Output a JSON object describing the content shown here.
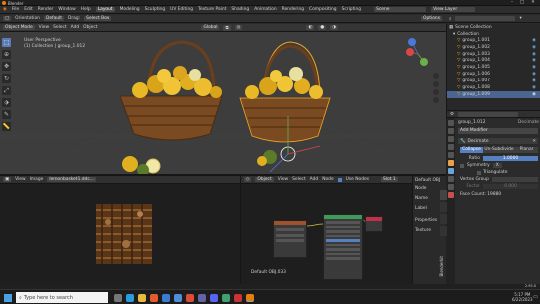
{
  "window": {
    "title": "Blender"
  },
  "menu": {
    "items": [
      "File",
      "Edit",
      "Render",
      "Window",
      "Help"
    ],
    "tabs": [
      "Layout",
      "Modeling",
      "Sculpting",
      "UV Editing",
      "Texture Paint",
      "Shading",
      "Animation",
      "Rendering",
      "Compositing",
      "Scripting"
    ],
    "scene": "Scene",
    "view_layer": "View Layer"
  },
  "tool_header": {
    "orientation_label": "Orientation",
    "orientation_value": "Default",
    "drag_label": "Drag:",
    "drag_value": "Select Box",
    "options": "Options"
  },
  "viewport_header": {
    "mode": "Object Mode",
    "items": [
      "View",
      "Select",
      "Add",
      "Object"
    ],
    "transform": "Global"
  },
  "viewport": {
    "line1": "User Perspective",
    "line2": "(1) Collection | group_1.012"
  },
  "outliner": {
    "title": "Scene Collection",
    "rows": [
      "Collection",
      "group_1.001",
      "group_1.002",
      "group_1.003",
      "group_1.004",
      "group_1.005",
      "group_1.006",
      "group_1.007",
      "group_1.008",
      "group_1.009"
    ],
    "selected_index": 9
  },
  "properties": {
    "object_name": "group_1.012",
    "modifier_label": "Decimate",
    "add_modifier": "Add Modifier",
    "modifier_name": "Decimate",
    "modes": [
      "Collapse",
      "Un-Subdivide",
      "Planar"
    ],
    "ratio_label": "Ratio",
    "ratio_value": "1.0000",
    "symmetry_label": "Symmetry",
    "symmetry_axis": "X",
    "triangulate_label": "Triangulate",
    "vertex_group_label": "Vertex Group",
    "factor_label": "Factor",
    "factor_value": "0.000",
    "face_count": "Face Count: 19880"
  },
  "image_editor": {
    "items": [
      "View",
      "Image"
    ],
    "image_name": "lemonbasket1.ddc..."
  },
  "node_editor": {
    "mode": "Object",
    "items": [
      "View",
      "Select",
      "Add",
      "Node"
    ],
    "use_nodes": "Use Nodes",
    "slot": "Slot 1",
    "material": "Default OBJ.033"
  },
  "node_sidebar": {
    "label": "Default OBJ",
    "items": [
      "Node",
      "Name",
      "Label",
      "Properties",
      "Texture"
    ],
    "tabs": [
      "Node",
      "Tool",
      "View",
      "Options"
    ],
    "vertical_tab": "Blenderkit"
  },
  "status": {
    "version": "2.93.0"
  },
  "taskbar": {
    "search_placeholder": "Type here to search",
    "time": "5:17 PM",
    "date": "6/22/2023"
  },
  "colors": {
    "accent": "#5680c2",
    "selection": "#f5a623",
    "fruit": "#e9b825",
    "basket": "#7a4a22"
  }
}
